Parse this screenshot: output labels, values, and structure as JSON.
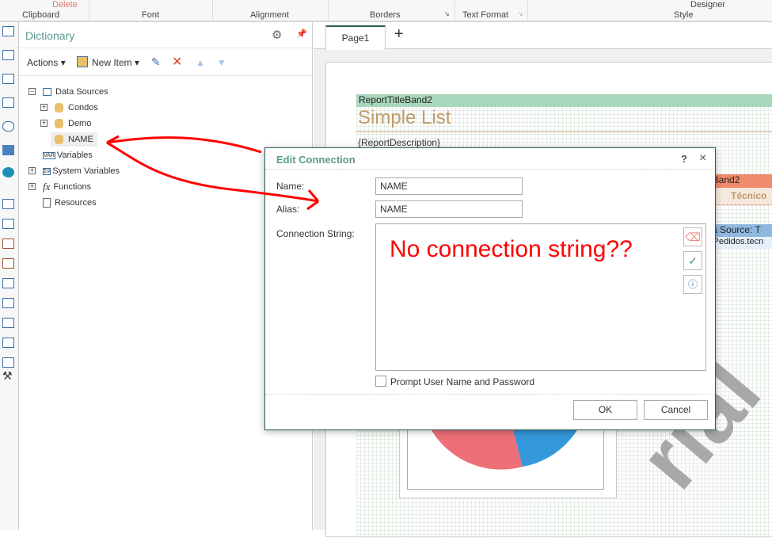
{
  "ribbon": {
    "groups": [
      "Clipboard",
      "Font",
      "Alignment",
      "Borders",
      "Text Format",
      "Style"
    ],
    "top_partial": [
      "Delete",
      "Designer"
    ]
  },
  "dictionary": {
    "title": "Dictionary",
    "toolbar": {
      "actions": "Actions",
      "new_item": "New Item"
    },
    "tree": {
      "data_sources": "Data Sources",
      "items": [
        "Condos",
        "Demo",
        "NAME"
      ],
      "variables": "Variables",
      "system_variables": "System Variables",
      "functions": "Functions",
      "resources": "Resources"
    }
  },
  "tabs": {
    "page1": "Page1",
    "add": "+"
  },
  "report": {
    "title_band": "ReportTitleBand2",
    "title": "Simple List",
    "description": "{ReportDescription}",
    "header_band": "erBand2",
    "header_cell": "Técnico",
    "data_band": "ata Source: T",
    "data_field": "osPedidos.tecn",
    "watermark": "rial"
  },
  "dialog": {
    "title": "Edit Connection",
    "help": "?",
    "close": "×",
    "name_label": "Name:",
    "name_value": "NAME",
    "alias_label": "Alias:",
    "alias_value": "NAME",
    "conn_label": "Connection String:",
    "conn_value": "",
    "prompt_label": "Prompt User Name and Password",
    "prompt_checked": false,
    "ok": "OK",
    "cancel": "Cancel"
  },
  "annotation": {
    "text": "No connection string??",
    "color": "#ff0000"
  },
  "colors": {
    "accent": "#5a9a8e",
    "title_band": "#a8d8bc",
    "header_band": "#f08a6c",
    "data_band": "#8fb8e0",
    "pie_red": "#ef6f78",
    "pie_blue": "#3598dc"
  }
}
